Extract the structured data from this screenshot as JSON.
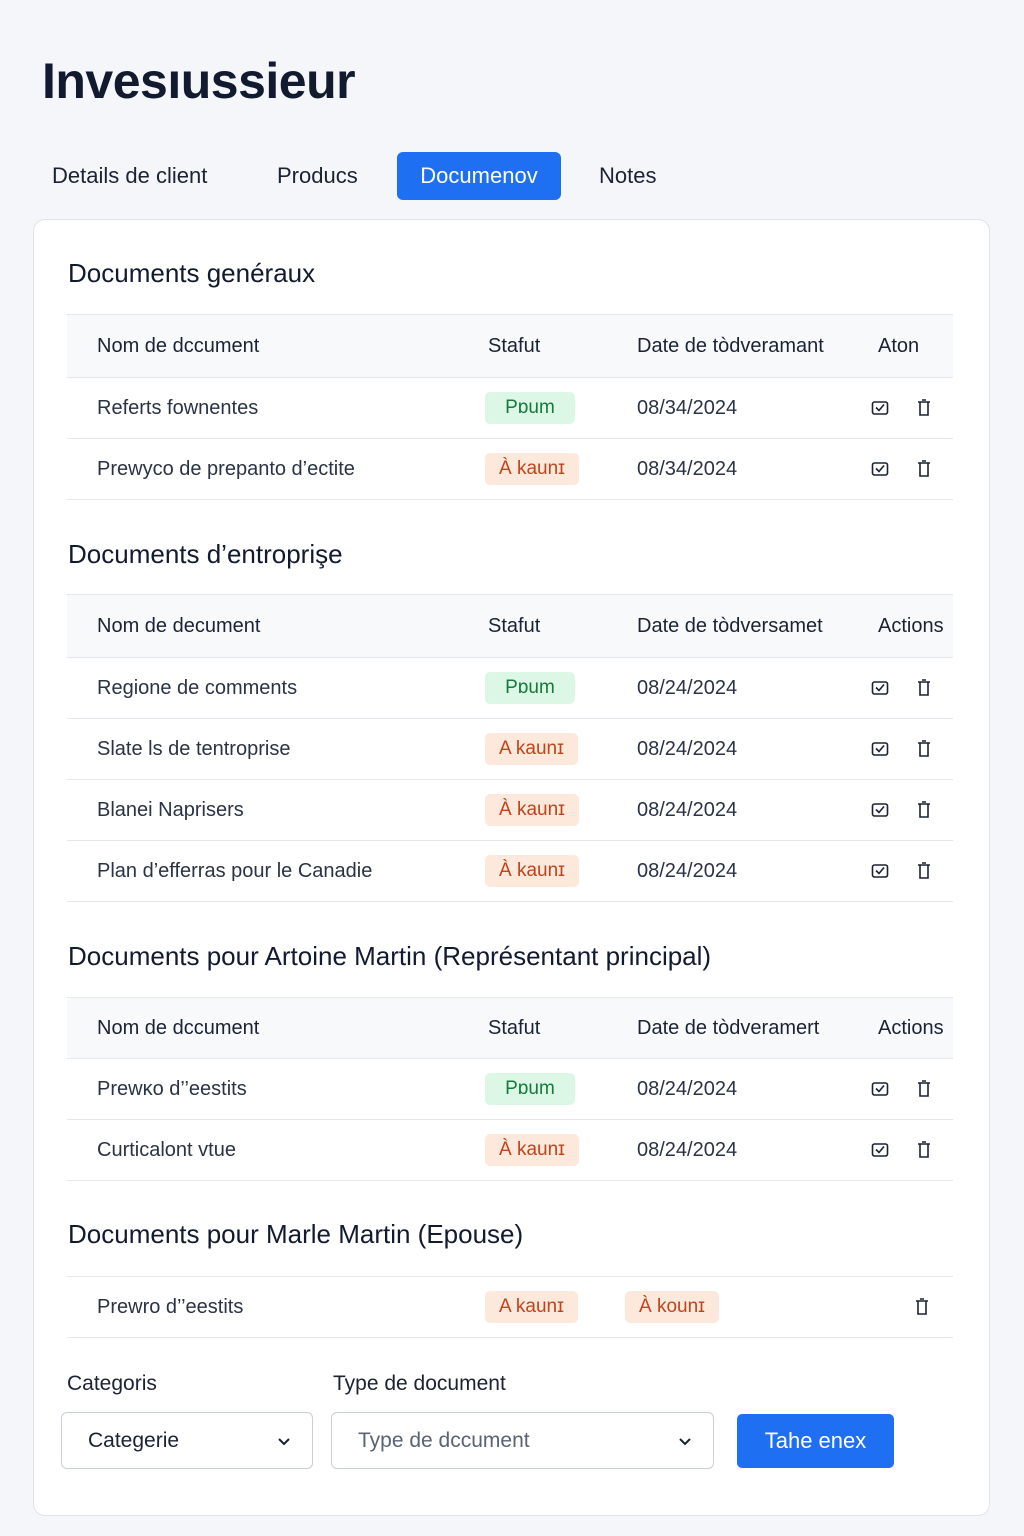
{
  "header": {
    "title": "Invesıussieur"
  },
  "tabs": [
    {
      "label": "Details de client"
    },
    {
      "label": "Producs"
    },
    {
      "label": "Documenov"
    },
    {
      "label": "Notes"
    }
  ],
  "sections": [
    {
      "title": "Documents genéraux",
      "columns": [
        "Nom de dccument",
        "Stafut",
        "Date de tòdveramant",
        "Aton"
      ],
      "rows": [
        {
          "name": "Referts fownentes",
          "status": "Pɒum",
          "date": "08/34/2024"
        },
        {
          "name": "Prewyco de prepanto d’ectite",
          "status": "À kaunɪ",
          "date": "08/34/2024"
        }
      ]
    },
    {
      "title": "Documents d’entroprişe",
      "columns": [
        "Nom de decument",
        "Stafut",
        "Date de tòdversamet",
        "Actions"
      ],
      "rows": [
        {
          "name": "Regione de comments",
          "status": "Pɒum",
          "date": "08/24/2024"
        },
        {
          "name": "Slate ls de tentroprise",
          "status": "A kaunɪ",
          "date": "08/24/2024"
        },
        {
          "name": "Blanei Naprisers",
          "status": "À kaunɪ",
          "date": "08/24/2024"
        },
        {
          "name": "Plan d’efferras pour le Canadie",
          "status": "À kaunɪ",
          "date": "08/24/2024"
        }
      ]
    },
    {
      "title": "Documents pour Artoine Martin (Représentant principal)",
      "columns": [
        "Nom de dccument",
        "Stafut",
        "Date de tòdveramert",
        "Actions"
      ],
      "rows": [
        {
          "name": "Prewκo d’’eestits",
          "status": "Pɒum",
          "date": "08/24/2024"
        },
        {
          "name": "Curticalont vtue",
          "status": "À kaunɪ",
          "date": "08/24/2024"
        }
      ]
    },
    {
      "title": "Documents pour Marle Martin (Epouse)",
      "rows": [
        {
          "name": "Prewro d’’eestits",
          "status": "A kaunɪ",
          "status2": "À kounɪ"
        }
      ]
    }
  ],
  "filters": {
    "category_label": "Categoris",
    "category_value": "Categerie",
    "type_label": "Type de document",
    "type_placeholder": "Type de dccument",
    "submit_label": "Tahe enex"
  },
  "colors": {
    "accent": "#1f6ff2",
    "status_green_bg": "#dcf7e5",
    "status_green_text": "#167a3b",
    "status_orange_bg": "#fde9dc",
    "status_orange_text": "#c0431a"
  },
  "icons": {
    "edit": "edit-icon",
    "delete": "trash-icon",
    "dropdown": "chevron-down-icon"
  }
}
